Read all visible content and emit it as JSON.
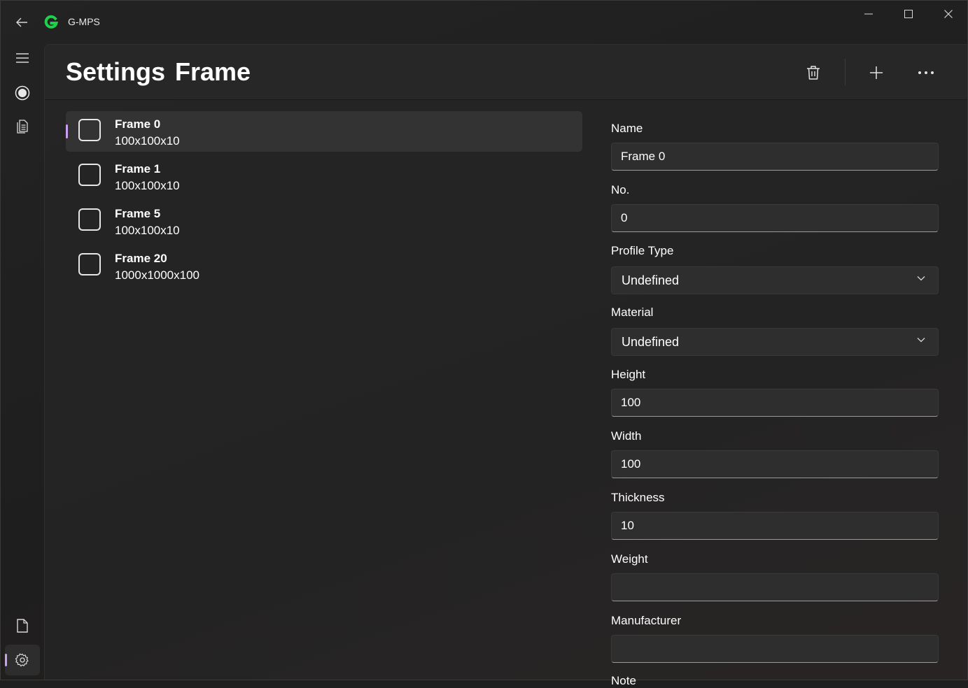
{
  "app": {
    "title": "G-MPS",
    "logo_color": "#1fd14a"
  },
  "breadcrumb": {
    "root": "Settings",
    "separator": "›",
    "current": "Frame"
  },
  "accent": "#c9a0f0",
  "list": {
    "items": [
      {
        "title": "Frame 0",
        "subtitle": "100x100x10",
        "selected": true
      },
      {
        "title": "Frame 1",
        "subtitle": "100x100x10",
        "selected": false
      },
      {
        "title": "Frame 5",
        "subtitle": "100x100x10",
        "selected": false
      },
      {
        "title": "Frame 20",
        "subtitle": "1000x1000x100",
        "selected": false
      }
    ]
  },
  "form": {
    "name": {
      "label": "Name",
      "value": "Frame 0"
    },
    "no": {
      "label": "No.",
      "value": "0"
    },
    "profile_type": {
      "label": "Profile Type",
      "value": "Undefined"
    },
    "material": {
      "label": "Material",
      "value": "Undefined"
    },
    "height": {
      "label": "Height",
      "value": "100"
    },
    "width": {
      "label": "Width",
      "value": "100"
    },
    "thickness": {
      "label": "Thickness",
      "value": "10"
    },
    "weight": {
      "label": "Weight",
      "value": ""
    },
    "manufacturer": {
      "label": "Manufacturer",
      "value": ""
    },
    "note": {
      "label": "Note"
    }
  },
  "icons": {
    "back": "back-arrow-icon",
    "menu": "hamburger-icon",
    "record": "record-icon",
    "documents": "documents-icon",
    "file": "file-icon",
    "settings": "gear-icon",
    "delete": "trash-icon",
    "add": "plus-icon",
    "more": "more-icon"
  }
}
